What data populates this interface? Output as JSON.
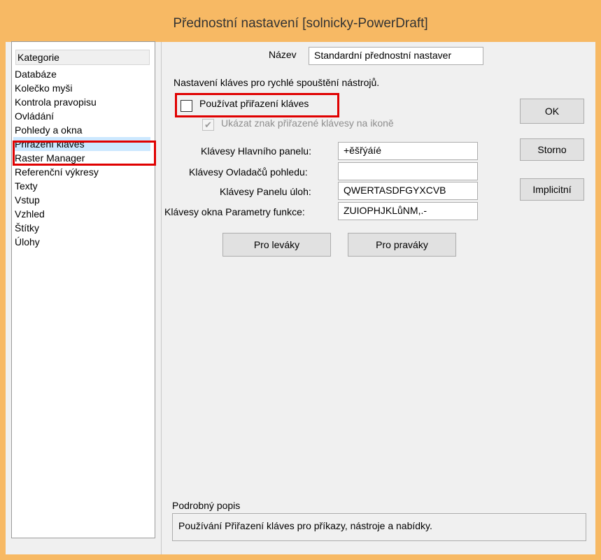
{
  "window": {
    "title": "Přednostní nastavení [solnicky-PowerDraft]"
  },
  "categories": {
    "header": "Kategorie",
    "items": [
      "Databáze",
      "Kolečko myši",
      "Kontrola pravopisu",
      "Ovládání",
      "Pohledy a okna",
      "Přiřazení kláves",
      "Raster Manager",
      "Referenční výkresy",
      "Texty",
      "Vstup",
      "Vzhled",
      "Štítky",
      "Úlohy"
    ],
    "selected": "Přiřazení kláves"
  },
  "name_row": {
    "label": "Název",
    "value": "Standardní přednostní nastaver"
  },
  "section_intro": "Nastavení kláves pro rychlé spouštění nástrojů.",
  "use_keys": {
    "label": "Používat přiřazení kláves",
    "checked": false
  },
  "show_key_icon": {
    "label": "Ukázat znak přiřazené klávesy na ikoně",
    "checked": true,
    "disabled": true
  },
  "fields": {
    "main_panel": {
      "label": "Klávesy Hlavního panelu:",
      "value": "+ěšřýáíé"
    },
    "view_controls": {
      "label": "Klávesy Ovladačů pohledu:",
      "value": ""
    },
    "task_panel": {
      "label": "Klávesy Panelu úloh:",
      "value": "QWERTASDFGYXCVB"
    },
    "params_window": {
      "label": "Klávesy okna Parametry funkce:",
      "value": "ZUIOPHJKLůNM,.-"
    }
  },
  "buttons": {
    "left_handed": "Pro leváky",
    "right_handed": "Pro praváky",
    "ok": "OK",
    "cancel": "Storno",
    "default": "Implicitní"
  },
  "details": {
    "label": "Podrobný popis",
    "text": "Používání Přiřazení kláves pro příkazy, nástroje a nabídky."
  },
  "colors": {
    "title_bar": "#f7b964",
    "selected_item": "#cce8ff",
    "highlight_box": "#e00000"
  }
}
